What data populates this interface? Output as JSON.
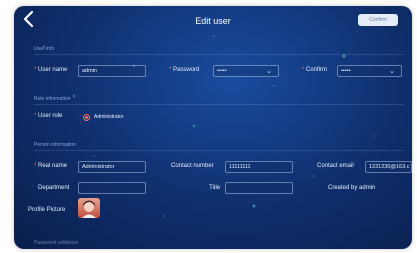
{
  "header": {
    "title": "Edit user",
    "confirm_label": "Confirm"
  },
  "sections": {
    "user_info": "User info",
    "role_info": "Role information",
    "person_info": "Person information",
    "password_validation": "Password validation"
  },
  "user_info": {
    "username_label": "User name",
    "username_value": "admin",
    "password_label": "Password",
    "password_value": "•••••",
    "confirm_label": "Confirm",
    "confirm_value": "•••••"
  },
  "role_info": {
    "label": "User role",
    "selected": "Administrator"
  },
  "person_info": {
    "real_name_label": "Real name",
    "real_name_value": "Administrator",
    "contact_number_label": "Contact number",
    "contact_number_value": "11111111",
    "contact_email_label": "Contact email",
    "contact_email_value": "1231230@163.c",
    "department_label": "Department",
    "department_value": "",
    "title_label": "Title",
    "title_value": "",
    "created_by_label": "Created by",
    "created_by_value": "admin",
    "profile_picture_label": "Profile Picture"
  },
  "colors": {
    "background": "#0f2e6b",
    "accent_required": "#ff6b6b",
    "text": "#e8efff"
  }
}
